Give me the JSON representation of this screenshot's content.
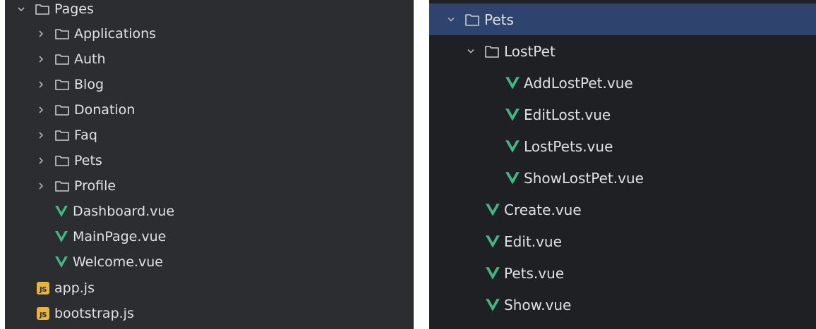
{
  "left_tree": {
    "root": {
      "label": "Pages",
      "expanded": true,
      "icon": "folder-icon"
    },
    "items": [
      {
        "label": "Applications",
        "type": "folder",
        "expanded": false
      },
      {
        "label": "Auth",
        "type": "folder",
        "expanded": false
      },
      {
        "label": "Blog",
        "type": "folder",
        "expanded": false
      },
      {
        "label": "Donation",
        "type": "folder",
        "expanded": false
      },
      {
        "label": "Faq",
        "type": "folder",
        "expanded": false
      },
      {
        "label": "Pets",
        "type": "folder",
        "expanded": false
      },
      {
        "label": "Profile",
        "type": "folder",
        "expanded": false
      },
      {
        "label": "Dashboard.vue",
        "type": "vue"
      },
      {
        "label": "MainPage.vue",
        "type": "vue"
      },
      {
        "label": "Welcome.vue",
        "type": "vue"
      }
    ],
    "root_files": [
      {
        "label": "app.js",
        "type": "js",
        "badge": "JS"
      },
      {
        "label": "bootstrap.js",
        "type": "js",
        "badge": "JS"
      }
    ]
  },
  "right_tree": {
    "root": {
      "label": "Pets",
      "expanded": true,
      "selected": true
    },
    "subfolder": {
      "label": "LostPet",
      "expanded": true,
      "items": [
        {
          "label": "AddLostPet.vue"
        },
        {
          "label": "EditLost.vue"
        },
        {
          "label": "LostPets.vue"
        },
        {
          "label": "ShowLostPet.vue"
        }
      ]
    },
    "items": [
      {
        "label": "Create.vue"
      },
      {
        "label": "Edit.vue"
      },
      {
        "label": "Pets.vue"
      },
      {
        "label": "Show.vue"
      }
    ]
  },
  "colors": {
    "panel_bg": "#2b2d30",
    "text": "#dfe1e5",
    "selection": "#2e436e",
    "vue_green": "#41b883",
    "js_yellow": "#e7b53a"
  }
}
